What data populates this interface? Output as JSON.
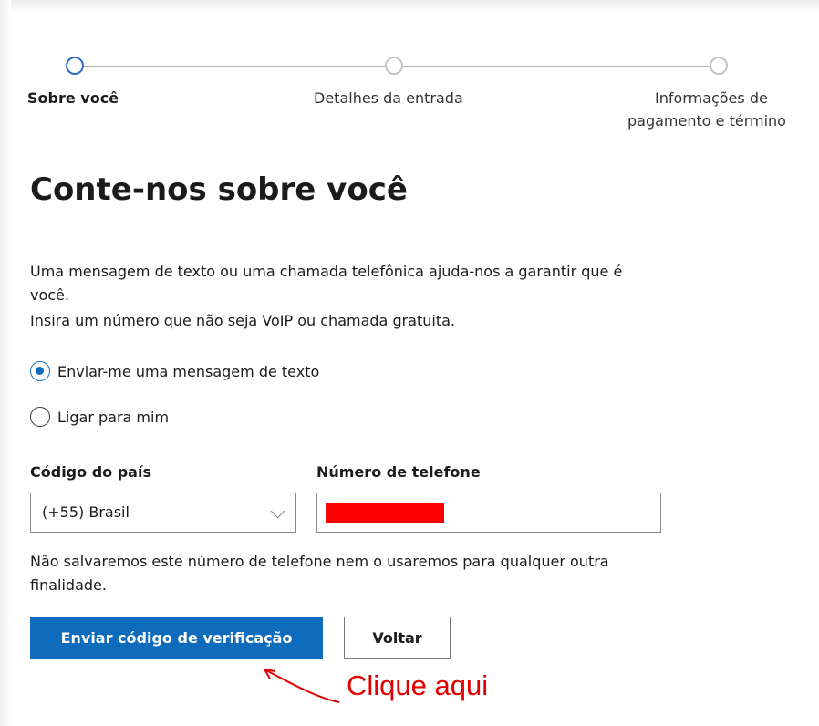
{
  "stepper": {
    "steps": [
      {
        "label": "Sobre você",
        "state": "active"
      },
      {
        "label": "Detalhes da entrada",
        "state": "inactive"
      },
      {
        "label_line1": "Informações de",
        "label_line2": "pagamento e término",
        "state": "inactive"
      }
    ]
  },
  "page": {
    "title": "Conte-nos sobre você",
    "desc_line1": "Uma mensagem de texto ou uma chamada telefônica ajuda-nos a garantir que é",
    "desc_line2": "você.",
    "desc_line3": "Insira um número que não seja VoIP ou chamada gratuita."
  },
  "options": [
    {
      "label": "Enviar-me uma mensagem de texto",
      "checked": true
    },
    {
      "label": "Ligar para mim",
      "checked": false
    }
  ],
  "form": {
    "country_label": "Código do país",
    "country_value": "(+55) Brasil",
    "phone_label": "Número de telefone",
    "note_line1": "Não salvaremos este número de telefone nem o usaremos para qualquer outra",
    "note_line2": "finalidade."
  },
  "buttons": {
    "send": "Enviar código de verificação",
    "back": "Voltar"
  },
  "annotation": {
    "text": "Clique aqui",
    "color": "#e00000"
  },
  "colors": {
    "accent": "#0f6cbd",
    "redaction": "#ff0000"
  }
}
